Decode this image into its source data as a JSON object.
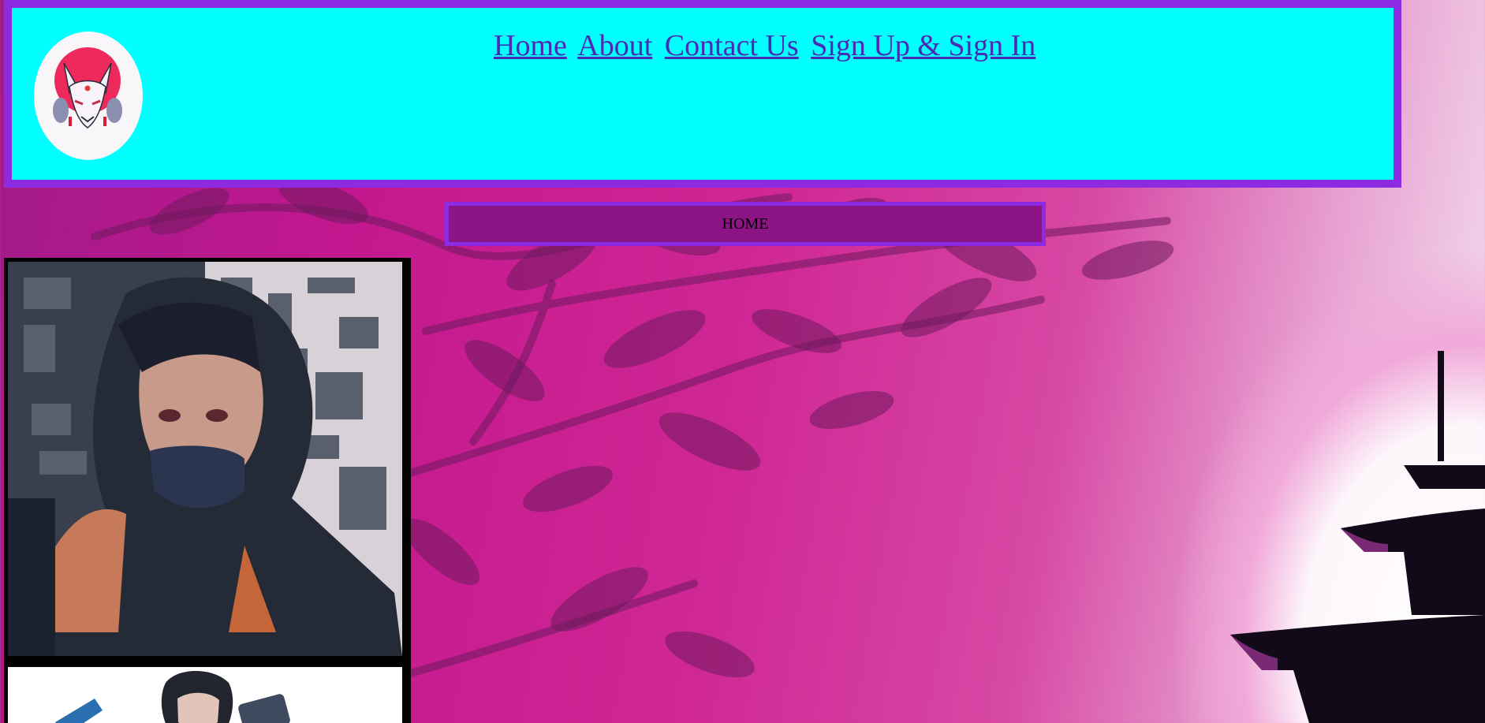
{
  "nav": {
    "items": [
      {
        "label": "Home"
      },
      {
        "label": "About"
      },
      {
        "label": "Contact Us"
      },
      {
        "label": "Sign Up & Sign In"
      }
    ]
  },
  "home_bar": {
    "label": "HOME"
  },
  "icons": {
    "logo": "kitsune-mask-logo-icon"
  },
  "colors": {
    "header_bg": "#00ffff",
    "header_border": "#8c2be2",
    "home_bar_bg": "#8d1485",
    "link": "#4b2ab4"
  }
}
